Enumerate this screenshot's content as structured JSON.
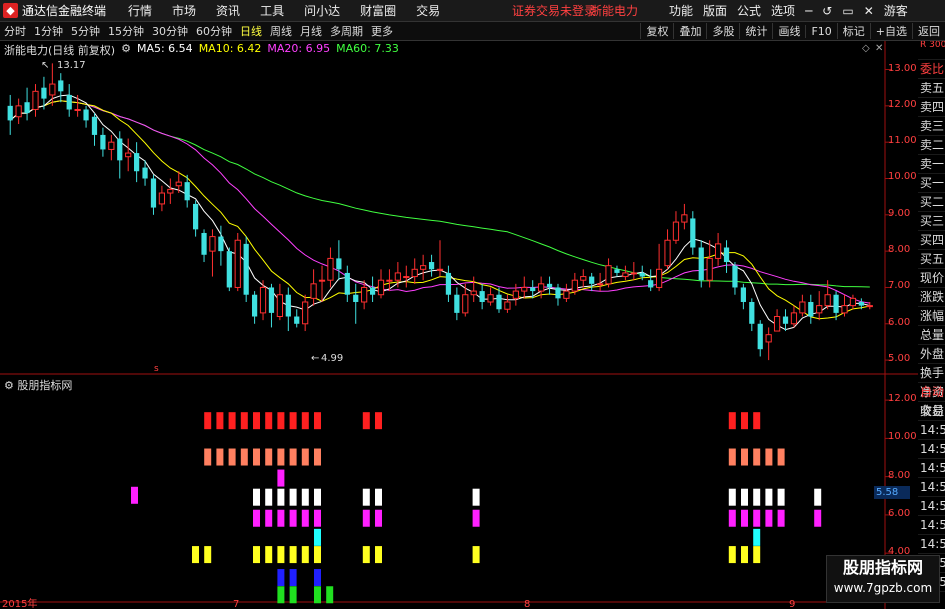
{
  "app": {
    "name": "通达信金融终端",
    "menu": [
      "行情",
      "市场",
      "资讯",
      "工具",
      "问小达",
      "财富圈",
      "交易"
    ],
    "status": "证券交易未登录",
    "stock_name": "浙能电力",
    "right_menu": [
      "功能",
      "版面",
      "公式",
      "选项",
      "游客"
    ]
  },
  "toolbar": {
    "periods": [
      "分时",
      "1分钟",
      "5分钟",
      "15分钟",
      "30分钟",
      "60分钟",
      "日线",
      "周线",
      "月线",
      "多周期",
      "更多"
    ],
    "active": "日线",
    "actions": [
      "复权",
      "叠加",
      "多股",
      "统计",
      "画线",
      "F10",
      "标记",
      "+自选",
      "返回"
    ]
  },
  "chart_header": {
    "title": "浙能电力(日线 前复权)",
    "ma5": "MA5: 6.54",
    "ma10": "MA10: 6.42",
    "ma20": "MA20: 6.95",
    "ma60": "MA60: 7.33",
    "ma5_color": "#ffffff",
    "ma10_color": "#ffff00",
    "ma20_color": "#ff40ff",
    "ma60_color": "#40ff40"
  },
  "price_axis": [
    "13.00",
    "12.00",
    "11.00",
    "10.00",
    "9.00",
    "8.00",
    "7.00",
    "6.00",
    "5.00"
  ],
  "annotations": {
    "high": "13.17",
    "low": "4.99"
  },
  "indicator": {
    "name": "股朋指标网",
    "axis": [
      "12.00",
      "10.00",
      "8.00",
      "6.00",
      "4.00",
      "2.00"
    ],
    "current_value": "5.58"
  },
  "time_axis": [
    "2015年",
    "7",
    "8",
    "9"
  ],
  "side_panel": [
    "委比",
    "卖五",
    "卖四",
    "卖三",
    "卖二",
    "卖一",
    "买一",
    "买二",
    "买三",
    "买四",
    "买五",
    "现价",
    "涨跌",
    "涨幅",
    "总量",
    "外盘",
    "换手",
    "净资",
    "收益"
  ],
  "side_tag": "R 300",
  "side_panel2": [
    "自动",
    "交易",
    "14:56",
    "14:56",
    "14:56",
    "14:56",
    "14:56",
    "14:56",
    "14:56",
    "14:56",
    "14:56",
    "14:56"
  ],
  "watermark": {
    "title": "股朋指标网",
    "url": "www.7gpzb.com"
  },
  "chart_data": [
    {
      "type": "candlestick",
      "title": "浙能电力(日线 前复权)",
      "ylim": [
        4.7,
        13.4
      ],
      "candles": [
        [
          12.0,
          11.6,
          12.3,
          11.2
        ],
        [
          11.7,
          12.0,
          12.2,
          11.5
        ],
        [
          12.1,
          11.8,
          12.5,
          11.6
        ],
        [
          11.9,
          12.4,
          12.6,
          11.7
        ],
        [
          12.5,
          12.2,
          12.8,
          11.9
        ],
        [
          12.3,
          12.6,
          13.17,
          12.0
        ],
        [
          12.7,
          12.4,
          12.9,
          12.1
        ],
        [
          12.3,
          11.9,
          12.6,
          11.7
        ],
        [
          11.9,
          11.9,
          12.3,
          11.7
        ],
        [
          11.9,
          11.6,
          12.0,
          11.4
        ],
        [
          11.7,
          11.2,
          11.8,
          10.9
        ],
        [
          11.2,
          10.8,
          11.4,
          10.6
        ],
        [
          10.8,
          11.0,
          11.2,
          10.5
        ],
        [
          11.1,
          10.5,
          11.3,
          10.0
        ],
        [
          10.6,
          10.7,
          11.1,
          10.2
        ],
        [
          10.7,
          10.2,
          11.0,
          9.9
        ],
        [
          10.3,
          10.0,
          10.5,
          9.8
        ],
        [
          10.0,
          9.2,
          10.1,
          9.0
        ],
        [
          9.3,
          9.6,
          9.8,
          9.1
        ],
        [
          9.6,
          9.7,
          10.0,
          9.3
        ],
        [
          9.8,
          9.9,
          10.2,
          9.6
        ],
        [
          9.9,
          9.4,
          10.1,
          9.2
        ],
        [
          9.3,
          8.6,
          9.4,
          8.4
        ],
        [
          8.5,
          7.9,
          8.6,
          7.7
        ],
        [
          8.0,
          8.4,
          8.6,
          7.3
        ],
        [
          8.4,
          8.0,
          8.7,
          7.6
        ],
        [
          8.0,
          7.0,
          8.1,
          6.9
        ],
        [
          7.0,
          8.3,
          8.5,
          6.9
        ],
        [
          8.2,
          6.8,
          8.4,
          6.6
        ],
        [
          6.8,
          6.2,
          6.9,
          6.0
        ],
        [
          6.3,
          7.0,
          7.2,
          6.1
        ],
        [
          7.0,
          6.3,
          7.1,
          5.9
        ],
        [
          6.2,
          6.8,
          7.1,
          6.1
        ],
        [
          6.8,
          6.2,
          7.0,
          5.8
        ],
        [
          6.2,
          6.0,
          6.4,
          5.9
        ],
        [
          6.0,
          6.6,
          6.8,
          5.8
        ],
        [
          6.7,
          7.1,
          7.5,
          6.5
        ],
        [
          7.2,
          7.2,
          7.6,
          6.6
        ],
        [
          7.2,
          7.8,
          8.1,
          7.0
        ],
        [
          7.8,
          7.5,
          8.3,
          7.2
        ],
        [
          7.4,
          6.8,
          7.6,
          6.6
        ],
        [
          6.8,
          6.6,
          7.1,
          6.0
        ],
        [
          6.6,
          7.0,
          7.2,
          6.4
        ],
        [
          7.0,
          6.8,
          7.3,
          6.6
        ],
        [
          6.8,
          7.2,
          7.5,
          6.7
        ],
        [
          7.2,
          7.2,
          7.5,
          6.9
        ],
        [
          7.2,
          7.4,
          7.7,
          7.0
        ],
        [
          7.3,
          7.3,
          7.6,
          7.0
        ],
        [
          7.3,
          7.5,
          7.8,
          7.1
        ],
        [
          7.5,
          7.6,
          7.9,
          7.2
        ],
        [
          7.7,
          7.5,
          7.9,
          7.3
        ],
        [
          7.5,
          7.5,
          8.3,
          7.3
        ],
        [
          7.4,
          6.8,
          7.6,
          6.6
        ],
        [
          6.8,
          6.3,
          7.0,
          6.1
        ],
        [
          6.3,
          6.8,
          7.1,
          6.2
        ],
        [
          6.8,
          6.9,
          7.3,
          6.6
        ],
        [
          6.9,
          6.6,
          7.1,
          6.4
        ],
        [
          6.6,
          6.8,
          7.0,
          6.5
        ],
        [
          6.8,
          6.4,
          7.0,
          6.3
        ],
        [
          6.4,
          6.6,
          6.8,
          6.3
        ],
        [
          6.7,
          6.9,
          7.1,
          6.5
        ],
        [
          6.9,
          7.0,
          7.3,
          6.7
        ],
        [
          7.0,
          6.9,
          7.2,
          6.7
        ],
        [
          6.9,
          7.1,
          7.3,
          6.7
        ],
        [
          7.1,
          7.0,
          7.3,
          6.8
        ],
        [
          7.0,
          6.7,
          7.1,
          6.5
        ],
        [
          6.7,
          6.9,
          7.1,
          6.6
        ],
        [
          6.9,
          7.2,
          7.4,
          6.8
        ],
        [
          7.2,
          7.3,
          7.5,
          7.0
        ],
        [
          7.3,
          7.1,
          7.4,
          6.9
        ],
        [
          7.1,
          7.1,
          7.4,
          6.9
        ],
        [
          7.1,
          7.6,
          7.8,
          7.0
        ],
        [
          7.5,
          7.4,
          7.6,
          7.3
        ],
        [
          7.3,
          7.4,
          7.6,
          7.2
        ],
        [
          7.4,
          7.4,
          7.7,
          7.2
        ],
        [
          7.4,
          7.3,
          7.6,
          7.2
        ],
        [
          7.2,
          7.0,
          7.5,
          6.9
        ],
        [
          7.0,
          7.5,
          8.2,
          6.9
        ],
        [
          7.6,
          8.3,
          8.6,
          7.5
        ],
        [
          8.3,
          8.8,
          9.1,
          8.2
        ],
        [
          8.8,
          9.0,
          9.3,
          8.6
        ],
        [
          8.9,
          8.1,
          9.1,
          7.9
        ],
        [
          8.1,
          7.2,
          8.3,
          7.0
        ],
        [
          7.2,
          7.8,
          8.3,
          7.0
        ],
        [
          7.8,
          8.2,
          8.5,
          7.6
        ],
        [
          8.1,
          7.7,
          8.3,
          7.4
        ],
        [
          7.6,
          7.0,
          7.7,
          6.8
        ],
        [
          7.0,
          6.6,
          7.1,
          6.4
        ],
        [
          6.6,
          6.0,
          6.7,
          5.8
        ],
        [
          6.0,
          5.3,
          6.1,
          5.1
        ],
        [
          5.5,
          5.7,
          5.9,
          5.0
        ],
        [
          5.8,
          6.2,
          6.4,
          5.8
        ],
        [
          6.2,
          6.0,
          6.4,
          5.8
        ],
        [
          6.0,
          6.3,
          6.5,
          5.9
        ],
        [
          6.3,
          6.6,
          6.8,
          6.2
        ],
        [
          6.6,
          6.2,
          6.8,
          6.0
        ],
        [
          6.3,
          6.5,
          6.9,
          6.1
        ],
        [
          6.5,
          6.8,
          7.2,
          6.4
        ],
        [
          6.8,
          6.3,
          6.9,
          6.1
        ],
        [
          6.3,
          6.5,
          6.8,
          6.2
        ],
        [
          6.5,
          6.7,
          6.8,
          6.4
        ],
        [
          6.6,
          6.5,
          6.7,
          6.4
        ],
        [
          6.5,
          6.5,
          6.6,
          6.4
        ]
      ]
    },
    {
      "type": "signal-blocks",
      "title": "股朋指标网",
      "ylim": [
        1.5,
        13.0
      ],
      "rows": [
        {
          "level": 10.9,
          "color": "#ff2020",
          "count": 10,
          "start": 16
        },
        {
          "level": 10.9,
          "color": "#ff2020",
          "count": 2,
          "start": 29
        },
        {
          "level": 10.9,
          "color": "#ff2020",
          "count": 3,
          "start": 59
        },
        {
          "level": 9.0,
          "color": "#ff8060",
          "count": 10,
          "start": 16
        },
        {
          "level": 9.0,
          "color": "#ff8060",
          "count": 5,
          "start": 59
        },
        {
          "level": 7.0,
          "color": "#ff20ff",
          "count": 1,
          "start": 10
        },
        {
          "level": 7.9,
          "color": "#ff20ff",
          "count": 1,
          "start": 22
        },
        {
          "level": 6.9,
          "color": "#ffffff",
          "count": 6,
          "start": 20
        },
        {
          "level": 6.9,
          "color": "#ffffff",
          "count": 2,
          "start": 29
        },
        {
          "level": 6.9,
          "color": "#ffffff",
          "count": 1,
          "start": 38
        },
        {
          "level": 6.9,
          "color": "#ffffff",
          "count": 5,
          "start": 59
        },
        {
          "level": 6.9,
          "color": "#ffffff",
          "count": 1,
          "start": 66
        },
        {
          "level": 5.8,
          "color": "#ff20ff",
          "count": 6,
          "start": 20
        },
        {
          "level": 5.8,
          "color": "#ff20ff",
          "count": 2,
          "start": 29
        },
        {
          "level": 5.8,
          "color": "#ff20ff",
          "count": 1,
          "start": 38
        },
        {
          "level": 5.8,
          "color": "#ff20ff",
          "count": 5,
          "start": 59
        },
        {
          "level": 5.8,
          "color": "#ff20ff",
          "count": 1,
          "start": 66
        },
        {
          "level": 4.8,
          "color": "#20ffff",
          "count": 1,
          "start": 25
        },
        {
          "level": 4.8,
          "color": "#20ffff",
          "count": 1,
          "start": 61
        },
        {
          "level": 3.9,
          "color": "#ffff20",
          "count": 2,
          "start": 15
        },
        {
          "level": 3.9,
          "color": "#ffff20",
          "count": 6,
          "start": 20
        },
        {
          "level": 3.9,
          "color": "#ffff20",
          "count": 2,
          "start": 29
        },
        {
          "level": 3.9,
          "color": "#ffff20",
          "count": 1,
          "start": 38
        },
        {
          "level": 3.9,
          "color": "#ffff20",
          "count": 3,
          "start": 59
        },
        {
          "level": 2.7,
          "color": "#2020ff",
          "count": 2,
          "start": 22
        },
        {
          "level": 2.7,
          "color": "#2020ff",
          "count": 1,
          "start": 25
        },
        {
          "level": 1.8,
          "color": "#20e020",
          "count": 2,
          "start": 22
        },
        {
          "level": 1.8,
          "color": "#20e020",
          "count": 2,
          "start": 25
        }
      ]
    }
  ]
}
